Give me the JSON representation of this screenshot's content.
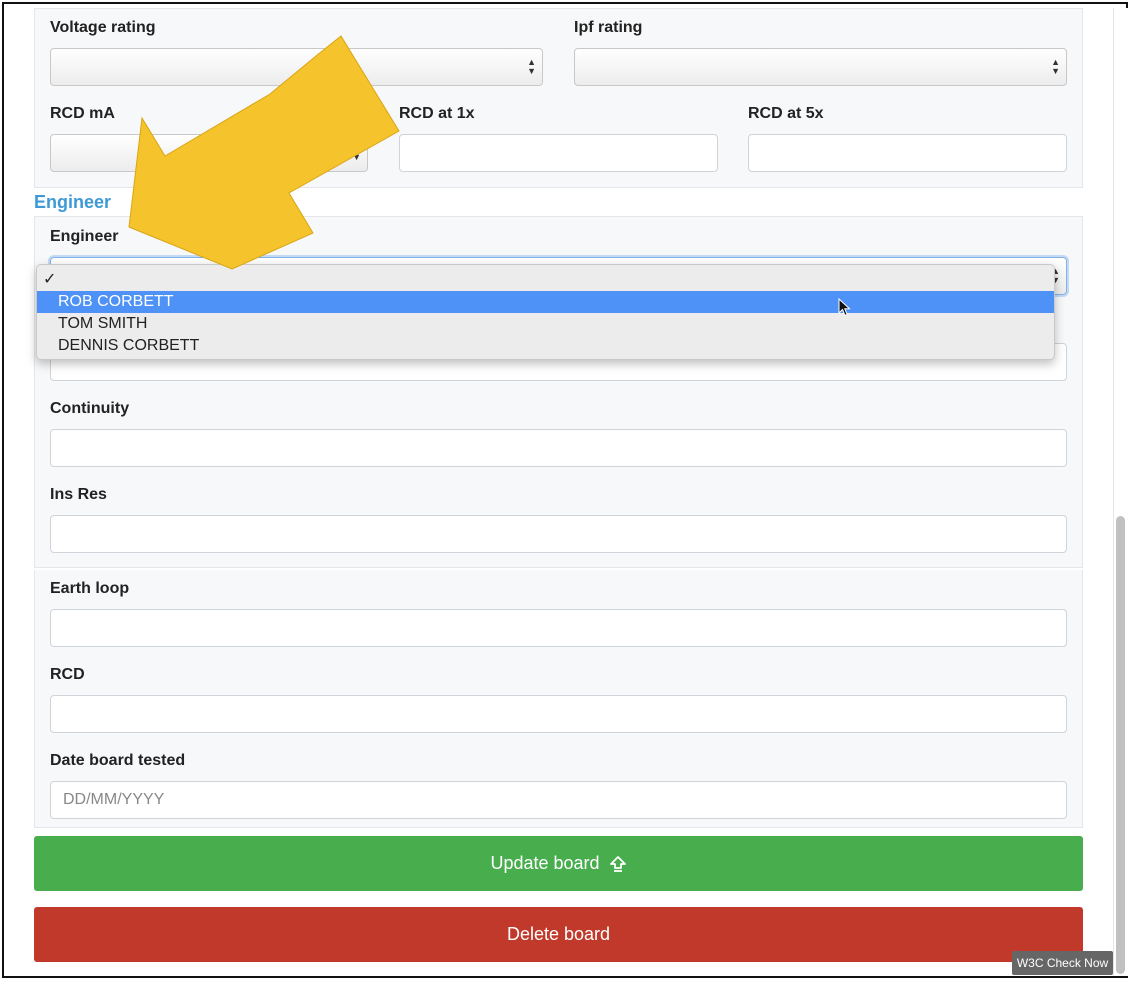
{
  "fields": {
    "voltage_rating": "Voltage rating",
    "ipf_rating": "Ipf rating",
    "rcd_ma": "RCD mA",
    "rcd_1x": "RCD at 1x",
    "rcd_5x": "RCD at 5x",
    "engineer": "Engineer",
    "continuity": "Continuity",
    "ins_res": "Ins Res",
    "earth_loop": "Earth loop",
    "rcd": "RCD",
    "date_tested": "Date board tested",
    "date_placeholder": "DD/MM/YYYY"
  },
  "section": {
    "engineer_heading": "Engineer"
  },
  "dropdown": {
    "checkmark": "✓",
    "options": [
      "ROB CORBETT",
      "TOM SMITH",
      "DENNIS CORBETT"
    ],
    "highlighted": "ROB CORBETT"
  },
  "buttons": {
    "update": "Update board",
    "update_icon": "upload-arrow-icon",
    "delete": "Delete board"
  },
  "badge": "W3C Check Now",
  "colors": {
    "section_link": "#3d9ad6",
    "update_button": "#47ad4d",
    "delete_button": "#c0392b",
    "highlight": "#4e92f7",
    "arrow": "#f5c32c"
  }
}
